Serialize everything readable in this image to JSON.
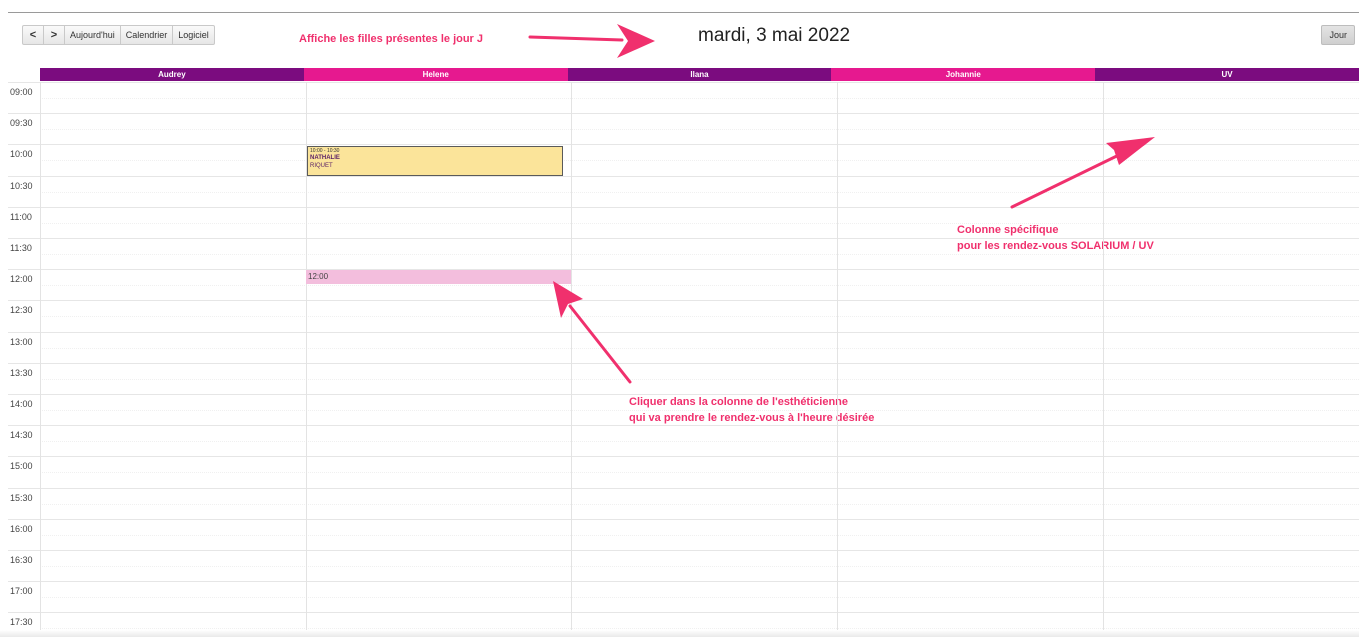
{
  "toolbar": {
    "prev_label": "<",
    "next_label": ">",
    "today_label": "Aujourd'hui",
    "calendar_label": "Calendrier",
    "software_label": "Logiciel"
  },
  "view_button_label": "Jour",
  "date_title": "mardi, 3 mai 2022",
  "annotations": {
    "top": "Affiche les filles présentes le jour J",
    "uv_line1": "Colonne spécifique",
    "uv_line2": "pour les rendez-vous SOLARIUM / UV",
    "click_line1": "Cliquer dans la colonne de l'esthéticienne",
    "click_line2": "qui va prendre le rendez-vous à l'heure désirée"
  },
  "columns": [
    {
      "name": "Audrey",
      "color": "#7b0c7f"
    },
    {
      "name": "Helene",
      "color": "#e6198f"
    },
    {
      "name": "Ilana",
      "color": "#7b0c7f"
    },
    {
      "name": "Johannie",
      "color": "#e6198f"
    },
    {
      "name": "UV",
      "color": "#7b0c7f"
    }
  ],
  "times": [
    "09:00",
    "09:30",
    "10:00",
    "10:30",
    "11:00",
    "11:30",
    "12:00",
    "12:30",
    "13:00",
    "13:30",
    "14:00",
    "14:30",
    "15:00",
    "15:30",
    "16:00",
    "16:30",
    "17:00",
    "17:30"
  ],
  "event": {
    "time": "10:00 - 10:30",
    "first_name": "NATHALIE",
    "last_name": "RIQUET",
    "color": "#fbe49a"
  },
  "selection": {
    "time": "12:00",
    "color": "#f3bedd"
  },
  "annotation_color": "#f0306d"
}
